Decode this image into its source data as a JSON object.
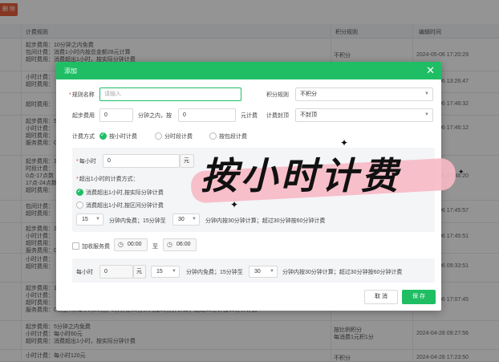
{
  "toolbar": {
    "delete_label": "删 除"
  },
  "table": {
    "headers": [
      "计费规则",
      "积分规则",
      "编辑时间"
    ],
    "rows": [
      {
        "rule": "起步费用：10分钟之内免费\n包间计费：消费1小时内按总金额28元计算\n超时费用：消费超出1小时，按实际分钟计费",
        "points": "不积分",
        "time": "2024-05-06 17:20:29"
      },
      {
        "rule": "小时计费：\n超时费用：",
        "points": "",
        "time": "2024-05-06 13:26:47"
      },
      {
        "rule": "超时费用：",
        "points": "",
        "time": "2024-05-06 17:46:32"
      },
      {
        "rule": "起步费用：5\n小时计费：\n超时费用：\n服务费用：0",
        "points": "",
        "time": "2024-05-06 17:46:12"
      },
      {
        "rule": "起步费用：3\n时段计费：\n0点-17点数\n17点-24点数\n超时费用：",
        "points": "",
        "time": "2024-05-06 17:46:20"
      },
      {
        "rule": "包间计费：\n超时费用：",
        "points": "",
        "time": "2024-05-06 17:45:57"
      },
      {
        "rule": "起步费用：3\n小时计费：\n超时费用：\n服务费用：0",
        "points": "",
        "time": "2024-05-06 17:45:51"
      },
      {
        "rule": "小时计费：\n超时费用：",
        "points": "",
        "time": "2024-05-06 09:33:51"
      },
      {
        "rule": "起步费用：10\n小时计费：\n超时费用：\n服务费用：0点至7点每小时20元；0分钟至30分钟内按30分钟计算；超过30分钟按60分钟计费",
        "points": "",
        "time": "2024-05-06 17:07:45"
      },
      {
        "rule": "起步费用：5分钟之内免费\n小时计费：每小时60元\n超时费用：消费超出1小时，按实际分钟计费",
        "points": "按比例积分\n每消费1元积1分",
        "time": "2024-04-28 09:27:56"
      },
      {
        "rule": "小时计费：每小时120元",
        "points": "不积分",
        "time": "2024-04-28 17:23:50"
      }
    ]
  },
  "dialog": {
    "title": "添加",
    "close": "✕",
    "name_label": "规则名称",
    "name_placeholder": "请输入",
    "points_label": "积分规则",
    "points_value": "不积分",
    "start_fee_label": "起步费用",
    "start_fee_min": "0",
    "start_fee_mid": "分钟之内，按",
    "start_fee_amount": "0",
    "start_fee_unit": "元计费",
    "cap_label": "计费封顶",
    "cap_value": "不封顶",
    "mode_label": "计费方式",
    "modes": [
      "按小时计费",
      "分时段计费",
      "按包段计费"
    ],
    "hourly_label": "每小时",
    "hourly_value": "0",
    "yuan": "元",
    "overtime_label": "超出1小时的计费方式：",
    "overtime_options": [
      "消费超出1小时,按实际分钟计费",
      "消费超出1小时,按区间分钟计费"
    ],
    "interval_a": "15",
    "interval_a_text": "分钟内免费；15分钟至",
    "interval_b": "30",
    "interval_b_text": "分钟内按30分钟计算；超过30分钟按60分钟计费",
    "service_label": "加收服务费",
    "time_start": "00:00",
    "time_to": "至",
    "time_end": "06:00",
    "svc_hourly_label": "每小时",
    "svc_hourly_value": "0",
    "svc_yuan": "元",
    "svc_a": "15",
    "svc_a_text": "分钟内免费；15分钟至",
    "svc_b": "30",
    "svc_b_text": "分钟内按30分钟计算；超过30分钟按60分钟计费",
    "cancel": "取 消",
    "save": "保 存"
  },
  "overlay_title": "按小时计费",
  "colors": {
    "accent": "#1fbe64",
    "danger": "#e5603a",
    "highlight": "#f7b9c4"
  }
}
